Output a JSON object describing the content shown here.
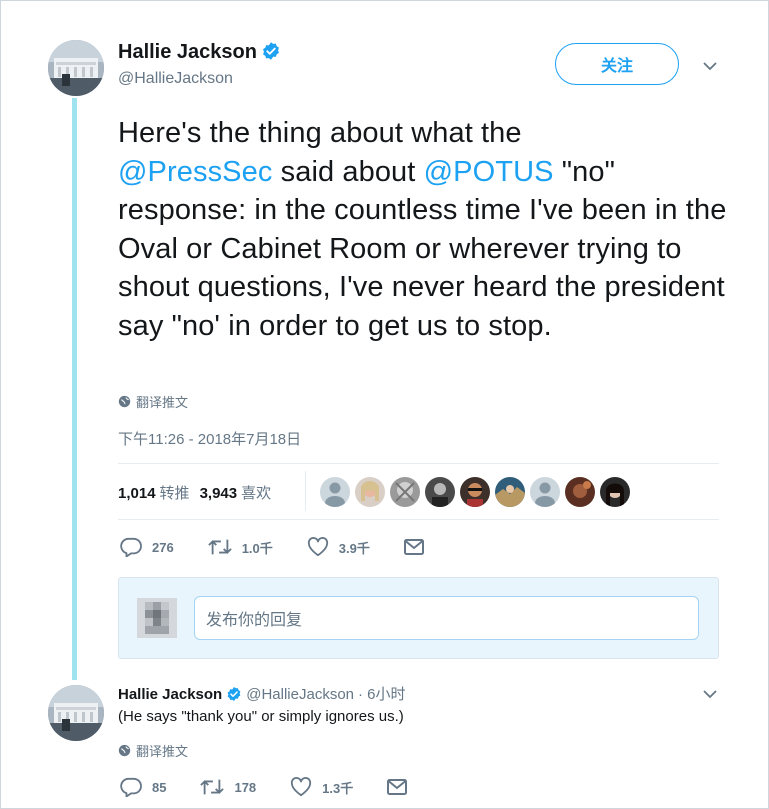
{
  "tweet": {
    "author": {
      "name": "Hallie Jackson",
      "handle": "@HallieJackson"
    },
    "follow_label": "关注",
    "text": {
      "part1": "Here's the thing about what the",
      "mention1": "@PressSec",
      "part2": " said about ",
      "mention2": "@POTUS",
      "part3": " \"no\" response: in the countless time I've been in the Oval or Cabinet Room or wherever trying to shout questions, I've never heard the president say \"no' in order to get us to stop."
    },
    "translate_label": "翻译推文",
    "timestamp": "下午11:26 - 2018年7月18日",
    "stats": {
      "retweets": "1,014",
      "retweets_label": "转推",
      "likes": "3,943",
      "likes_label": "喜欢"
    },
    "actions": {
      "replies": "276",
      "retweets": "1.0千",
      "likes": "3.9千"
    }
  },
  "reply_box": {
    "placeholder": "发布你的回复"
  },
  "reply": {
    "name": "Hallie Jackson",
    "handle": "@HallieJackson",
    "time": "· 6小时",
    "text": "(He says \"thank you\" or simply ignores us.)",
    "translate_label": "翻译推文",
    "actions": {
      "replies": "85",
      "retweets": "178",
      "likes": "1.3千"
    }
  },
  "colors": {
    "accent": "#1da1f2",
    "thread_line": "#9fe3ee",
    "muted": "#657786"
  }
}
